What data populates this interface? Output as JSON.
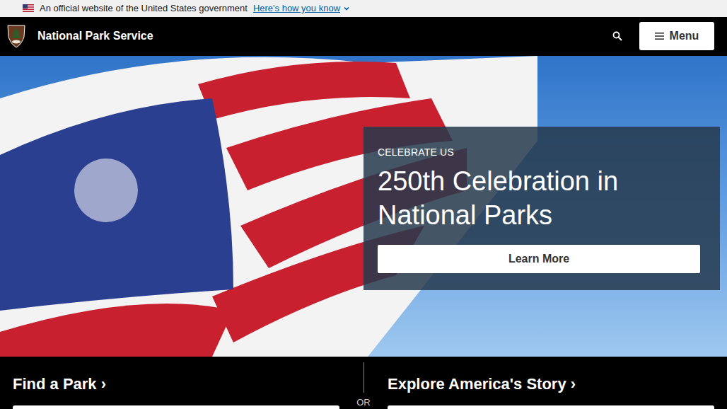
{
  "banner": {
    "text": "An official website of the United States government",
    "link": "Here's how you know"
  },
  "header": {
    "title": "National Park Service",
    "menu_button": "Menu"
  },
  "hero": {
    "eyebrow": "CELEBRATE US",
    "title": "250th Celebration in National Parks",
    "button": "Learn More"
  },
  "sections": [
    {
      "title": "Find a Park",
      "arrow": "›"
    },
    {
      "title": "Explore America's Story",
      "arrow": "›"
    }
  ],
  "divider": "OR"
}
